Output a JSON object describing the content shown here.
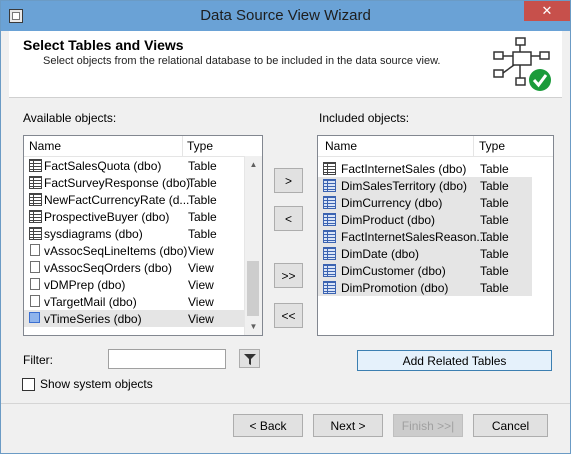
{
  "window": {
    "title": "Data Source View Wizard",
    "close_glyph": "✕",
    "min_glyph": "—",
    "max_glyph": "☐"
  },
  "header": {
    "title": "Select Tables and Views",
    "subtitle": "Select objects from the relational database to be included in the data source view."
  },
  "available": {
    "label": "Available objects:",
    "col_name": "Name",
    "col_type": "Type",
    "rows": [
      {
        "name": "FactSalesQuota (dbo)",
        "type": "Table",
        "icon": "table-icon"
      },
      {
        "name": "FactSurveyResponse (dbo)",
        "type": "Table",
        "icon": "table-icon"
      },
      {
        "name": "NewFactCurrencyRate (d...",
        "type": "Table",
        "icon": "table-icon"
      },
      {
        "name": "ProspectiveBuyer (dbo)",
        "type": "Table",
        "icon": "table-icon"
      },
      {
        "name": "sysdiagrams (dbo)",
        "type": "Table",
        "icon": "table-icon"
      },
      {
        "name": "vAssocSeqLineItems (dbo)",
        "type": "View",
        "icon": "view-icon"
      },
      {
        "name": "vAssocSeqOrders (dbo)",
        "type": "View",
        "icon": "view-icon"
      },
      {
        "name": "vDMPrep (dbo)",
        "type": "View",
        "icon": "view-icon"
      },
      {
        "name": "vTargetMail (dbo)",
        "type": "View",
        "icon": "view-icon"
      },
      {
        "name": "vTimeSeries (dbo)",
        "type": "View",
        "icon": "view-icon"
      }
    ]
  },
  "included": {
    "label": "Included objects:",
    "col_name": "Name",
    "col_type": "Type",
    "rows": [
      {
        "name": "FactInternetSales (dbo)",
        "type": "Table"
      },
      {
        "name": "DimSalesTerritory (dbo)",
        "type": "Table"
      },
      {
        "name": "DimCurrency (dbo)",
        "type": "Table"
      },
      {
        "name": "DimProduct (dbo)",
        "type": "Table"
      },
      {
        "name": "FactInternetSalesReason...",
        "type": "Table"
      },
      {
        "name": "DimDate (dbo)",
        "type": "Table"
      },
      {
        "name": "DimCustomer (dbo)",
        "type": "Table"
      },
      {
        "name": "DimPromotion (dbo)",
        "type": "Table"
      }
    ]
  },
  "move_buttons": {
    "add": ">",
    "remove": "<",
    "add_all": ">>",
    "remove_all": "<<"
  },
  "filter": {
    "label": "Filter:",
    "value": "",
    "icon": "filter-icon"
  },
  "add_related": "Add Related Tables",
  "show_system": {
    "label": "Show system objects",
    "checked": false
  },
  "nav": {
    "back": "< Back",
    "next": "Next >",
    "finish": "Finish >>|",
    "cancel": "Cancel"
  },
  "colors": {
    "titlebar": "#6aa2d6",
    "close": "#c7504b",
    "selected_row": "#e5e5e5",
    "check_green": "#1a9b3a"
  }
}
